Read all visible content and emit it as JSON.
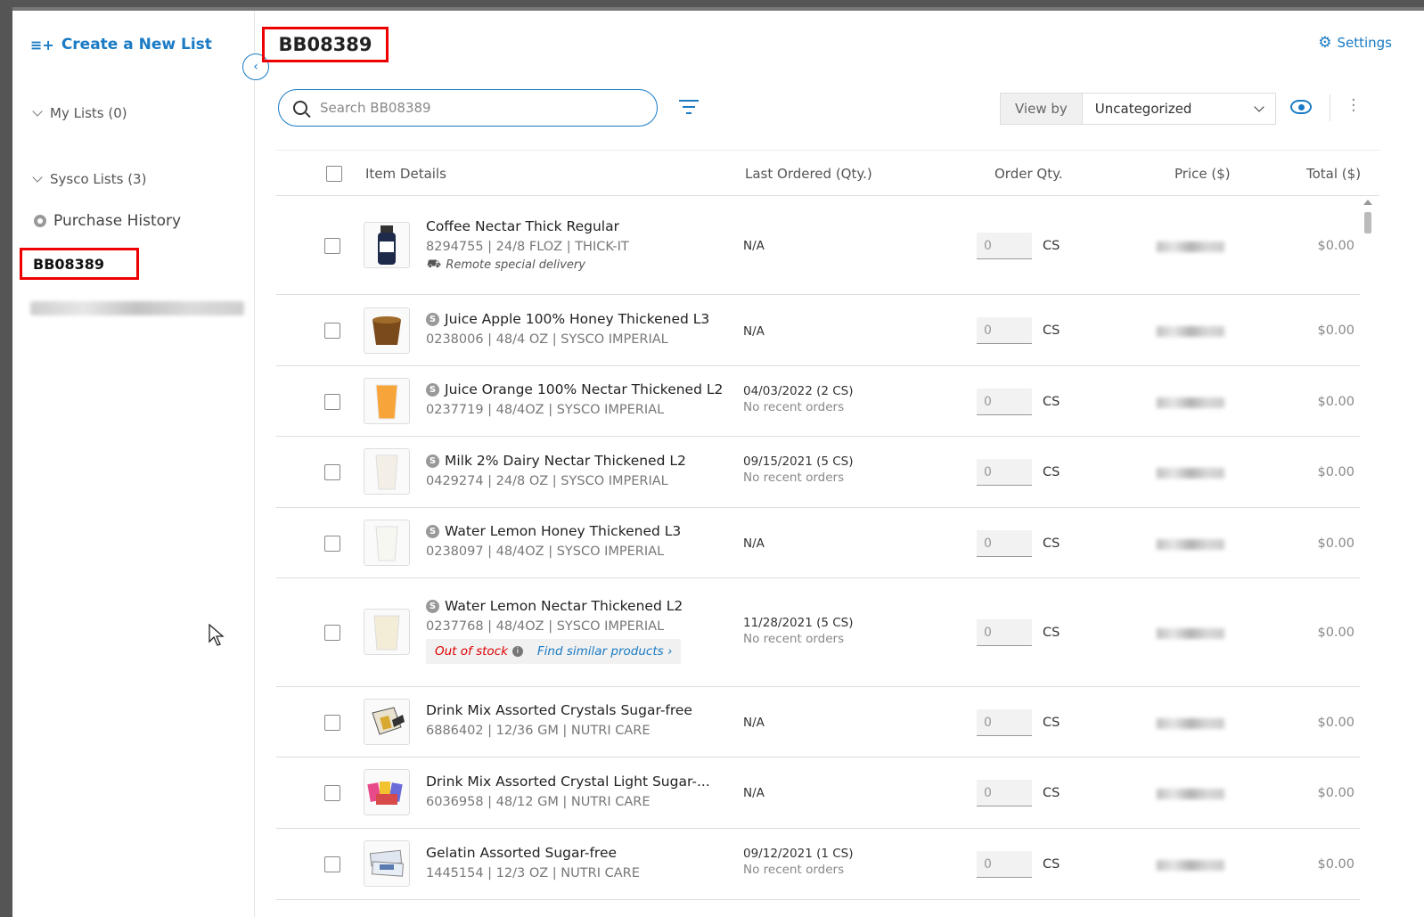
{
  "sidebar": {
    "create_label": "Create a New List",
    "my_lists": "My Lists (0)",
    "sysco_lists": "Sysco Lists (3)",
    "purchase_history": "Purchase History",
    "active_list": "BB08389"
  },
  "header": {
    "title": "BB08389",
    "settings": "Settings"
  },
  "search": {
    "placeholder": "Search BB08389"
  },
  "viewby": {
    "label": "View by",
    "selected": "Uncategorized"
  },
  "table": {
    "columns": {
      "item": "Item Details",
      "last": "Last Ordered (Qty.)",
      "qty": "Order Qty.",
      "price": "Price ($)",
      "total": "Total ($)"
    },
    "rows": [
      {
        "name": "Coffee Nectar Thick Regular",
        "meta": "8294755 | 24/8 FLOZ | THICK-IT",
        "note": "Remote special delivery",
        "last": "N/A",
        "last_sub": "",
        "qty": "0",
        "unit": "CS",
        "total": "$0.00"
      },
      {
        "name": "Juice Apple 100% Honey Thickened L3",
        "meta": "0238006 | 48/4 OZ | SYSCO IMPERIAL",
        "last": "N/A",
        "last_sub": "",
        "qty": "0",
        "unit": "CS",
        "total": "$0.00"
      },
      {
        "name": "Juice Orange 100% Nectar Thickened L2",
        "meta": "0237719 | 48/4OZ | SYSCO IMPERIAL",
        "last": "04/03/2022  (2 CS)",
        "last_sub": "No recent orders",
        "qty": "0",
        "unit": "CS",
        "total": "$0.00"
      },
      {
        "name": "Milk 2% Dairy Nectar Thickened L2",
        "meta": "0429274 | 24/8 OZ | SYSCO IMPERIAL",
        "last": "09/15/2021  (5 CS)",
        "last_sub": "No recent orders",
        "qty": "0",
        "unit": "CS",
        "total": "$0.00"
      },
      {
        "name": "Water Lemon Honey Thickened L3",
        "meta": "0238097 | 48/4OZ | SYSCO IMPERIAL",
        "last": "N/A",
        "last_sub": "",
        "qty": "0",
        "unit": "CS",
        "total": "$0.00"
      },
      {
        "name": "Water Lemon Nectar Thickened L2",
        "meta": "0237768 | 48/4OZ | SYSCO IMPERIAL",
        "oos": "Out of stock",
        "similar": "Find similar products",
        "last": "11/28/2021  (5 CS)",
        "last_sub": "No recent orders",
        "qty": "0",
        "unit": "CS",
        "total": "$0.00"
      },
      {
        "name": "Drink Mix Assorted Crystals Sugar-free",
        "meta": "6886402 | 12/36 GM | NUTRI CARE",
        "last": "N/A",
        "last_sub": "",
        "qty": "0",
        "unit": "CS",
        "total": "$0.00"
      },
      {
        "name": "Drink Mix Assorted Crystal Light Sugar-...",
        "meta": "6036958 | 48/12 GM | NUTRI CARE",
        "last": "N/A",
        "last_sub": "",
        "qty": "0",
        "unit": "CS",
        "total": "$0.00"
      },
      {
        "name": "Gelatin Assorted Sugar-free",
        "meta": "1445154 | 12/3 OZ | NUTRI CARE",
        "last": "09/12/2021  (1 CS)",
        "last_sub": "No recent orders",
        "qty": "0",
        "unit": "CS",
        "total": "$0.00"
      }
    ]
  },
  "colors": {
    "accent": "#1a7bc4",
    "highlight": "#e00000",
    "out_of_stock": "#d00000"
  }
}
